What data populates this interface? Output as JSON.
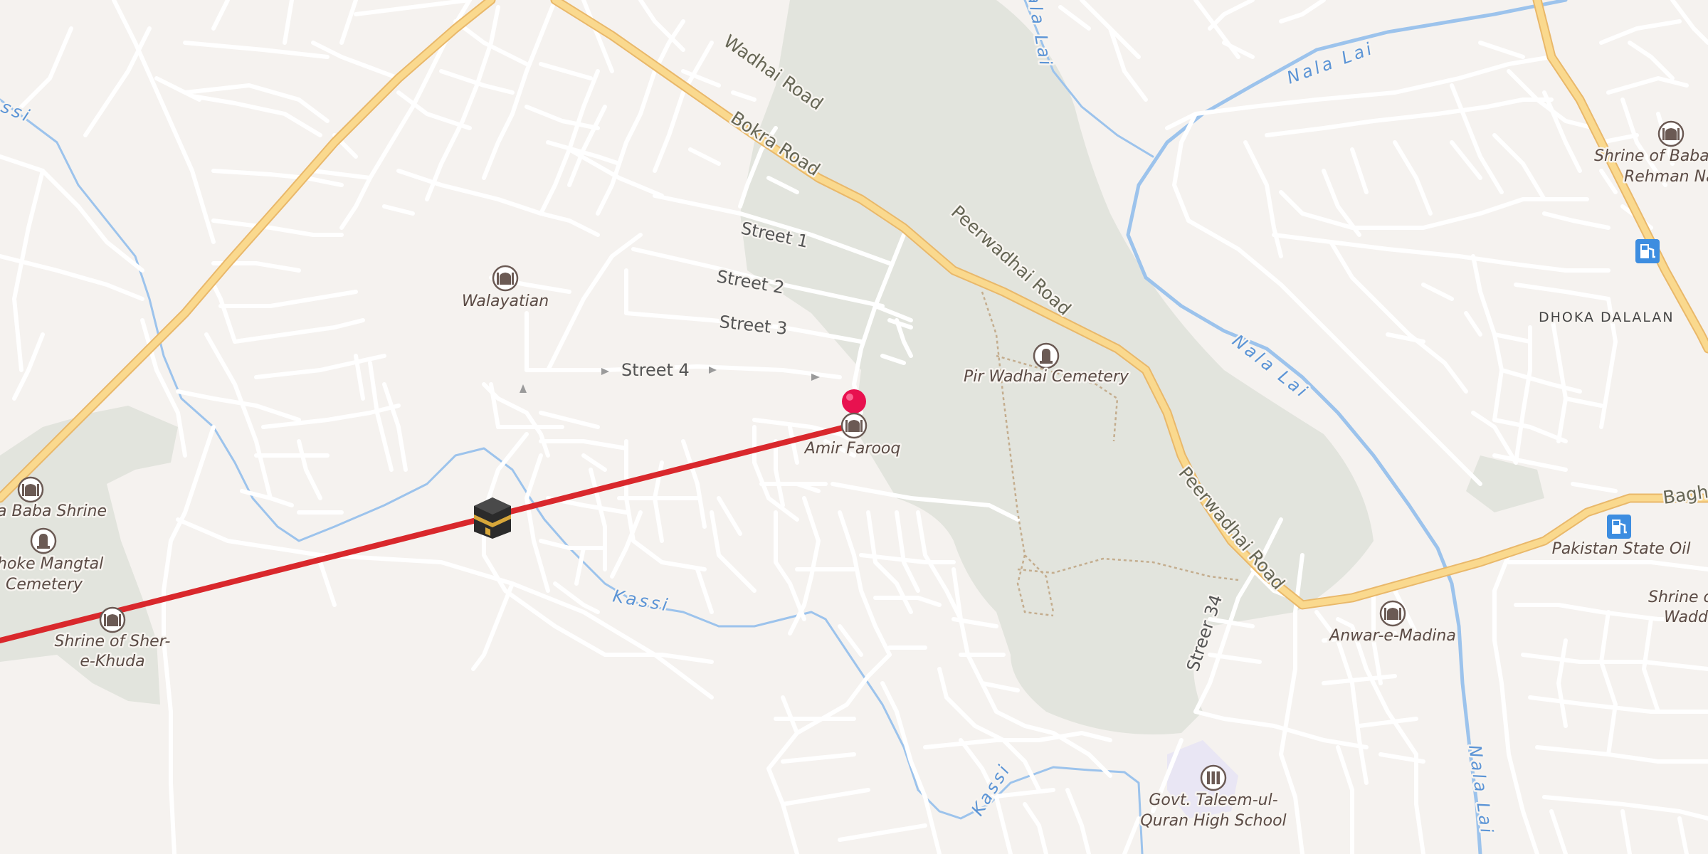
{
  "map": {
    "roads": [
      {
        "name": "Bokra Road"
      },
      {
        "name": "Peerwadhai Road"
      },
      {
        "name": "Wadhai Road"
      },
      {
        "name": "Baghi"
      },
      {
        "name": "Streer 34"
      }
    ],
    "streets": [
      "Street 1",
      "Street 2",
      "Street 3",
      "Street 4"
    ],
    "waterways": [
      "Kassi",
      "Nala Lai"
    ],
    "areas": [
      "DHOKA DALALAN"
    ],
    "pois": [
      {
        "name": "Walayatian",
        "type": "mosque",
        "icon": "mosque-icon"
      },
      {
        "name": "Pir Wadhai Cemetery",
        "type": "cemetery",
        "icon": "cemetery-icon"
      },
      {
        "name": "Amir Farooq",
        "type": "mosque",
        "icon": "mosque-icon"
      },
      {
        "name": "a Baba Shrine",
        "type": "shrine",
        "icon": "shrine-icon"
      },
      {
        "name": "hoke Mangtal",
        "name2": "Cemetery",
        "type": "cemetery",
        "icon": "cemetery-icon"
      },
      {
        "name": "Shrine of Sher-",
        "name2": "e-Khuda",
        "type": "shrine",
        "icon": "shrine-icon"
      },
      {
        "name": "Shrine of Baba A",
        "name2": "Rehman Nagp",
        "type": "shrine",
        "icon": "shrine-icon"
      },
      {
        "name": "Pakistan State Oil",
        "type": "fuel",
        "icon": "fuel-station-icon"
      },
      {
        "name": "Anwar-e-Madina",
        "type": "mosque",
        "icon": "mosque-icon"
      },
      {
        "name": "Shrine of",
        "name2": "Wadd",
        "type": "shrine",
        "icon": "shrine-icon"
      },
      {
        "name": "Govt. Taleem-ul-",
        "name2": "Quran High School",
        "type": "school",
        "icon": "school-icon"
      }
    ],
    "marker": {
      "icon": "map-pin-icon",
      "color": "#e8114f"
    },
    "qibla_icon": "kaaba-icon",
    "qibla_line_color": "#d9282c",
    "colors": {
      "background": "#f5f2ef",
      "minor_road": "#ffffff",
      "major_road": "#fad98e",
      "major_road_casing": "#e9b86a",
      "green_area": "#e2e4dd",
      "water": "#9cc3ec",
      "school_area": "#e9e6f4"
    }
  }
}
